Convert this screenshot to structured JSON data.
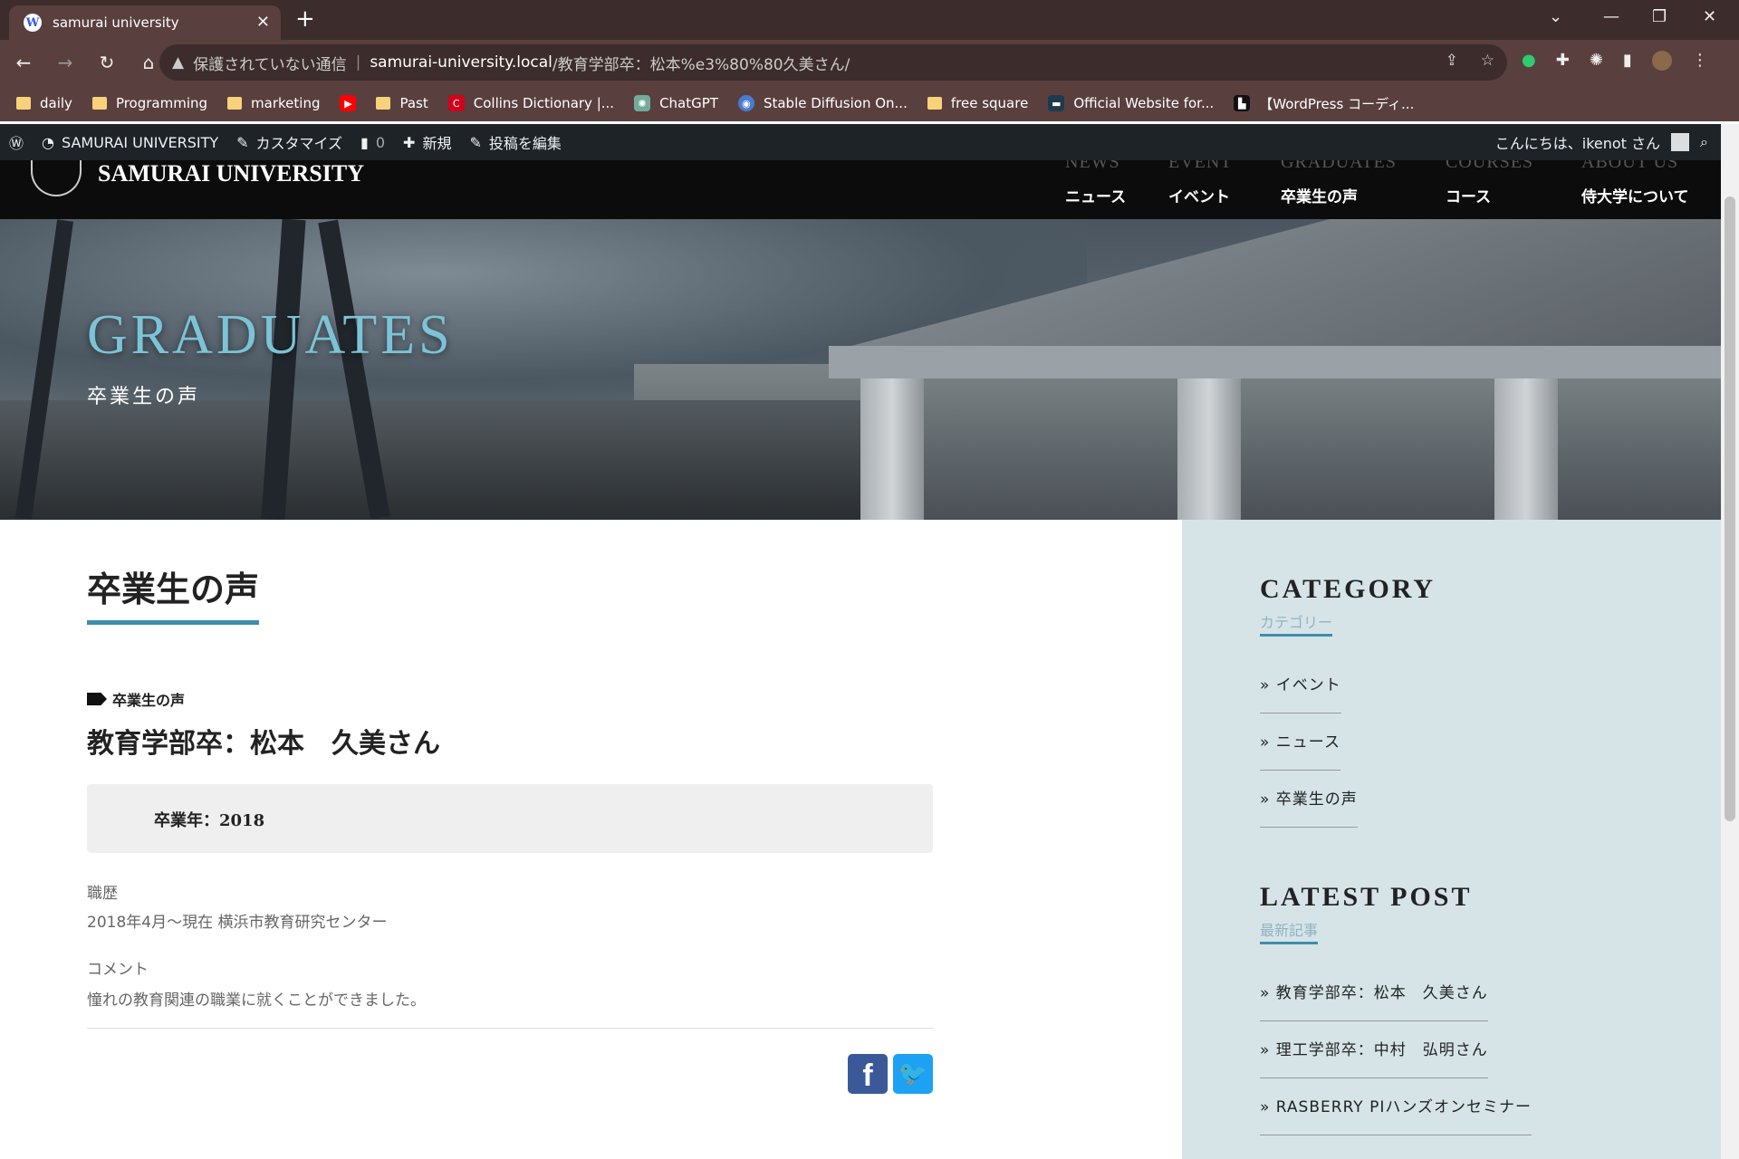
{
  "browser": {
    "tab_title": "samurai university",
    "tab_close": "✕",
    "new_tab": "+",
    "address_warning": "保護されていない通信",
    "address_host": "samurai-university.local",
    "address_path": "/教育学部卒：松本%e3%80%80久美さん/",
    "bookmarks": [
      {
        "label": "daily",
        "icon": "folder-icon"
      },
      {
        "label": "Programming",
        "icon": "folder-icon"
      },
      {
        "label": "marketing",
        "icon": "folder-icon"
      },
      {
        "label": "",
        "icon": "youtube-icon"
      },
      {
        "label": "Past",
        "icon": "folder-icon"
      },
      {
        "label": "Collins Dictionary |...",
        "icon": "collins-icon"
      },
      {
        "label": "ChatGPT",
        "icon": "chatgpt-icon"
      },
      {
        "label": "Stable Diffusion On...",
        "icon": "stable-diffusion-icon"
      },
      {
        "label": "free square",
        "icon": "folder-icon"
      },
      {
        "label": "Official Website for...",
        "icon": "site-icon"
      },
      {
        "label": "【WordPress コーディ...",
        "icon": "site-icon"
      }
    ]
  },
  "adminbar": {
    "site_name": "SAMURAI UNIVERSITY",
    "customize": "カスタマイズ",
    "comments_count": "0",
    "new": "新規",
    "edit_post": "投稿を編集",
    "greeting": "こんにちは、ikenot さん"
  },
  "site": {
    "name": "SAMURAI UNIVERSITY",
    "nav": [
      {
        "en": "NEWS",
        "ja": "ニュース"
      },
      {
        "en": "EVENT",
        "ja": "イベント"
      },
      {
        "en": "GRADUATES",
        "ja": "卒業生の声"
      },
      {
        "en": "COURSES",
        "ja": "コース"
      },
      {
        "en": "ABOUT US",
        "ja": "侍大学について"
      }
    ]
  },
  "hero": {
    "title": "GRADUATES",
    "subtitle": "卒業生の声"
  },
  "main": {
    "page_heading": "卒業生の声",
    "category_tag": "卒業生の声",
    "post_title": "教育学部卒：松本　久美さん",
    "graduation_year": "卒業年：2018",
    "career_label": "職歴",
    "career_value": "2018年4月〜現在 横浜市教育研究センター",
    "comment_label": "コメント",
    "comment_value": "憧れの教育関連の職業に就くことができました。"
  },
  "sidebar": {
    "category_heading": "CATEGORY",
    "category_sub": "カテゴリー",
    "categories": [
      "» イベント",
      "» ニュース",
      "» 卒業生の声"
    ],
    "latest_heading": "LATEST POST",
    "latest_sub": "最新記事",
    "latest_posts": [
      "» 教育学部卒：松本　久美さん",
      "» 理工学部卒：中村　弘明さん",
      "» RASBERRY PIハンズオンセミナー"
    ]
  },
  "colors": {
    "accent": "#3e8fab",
    "hero_title": "#7cc3d7",
    "sidebar_bg": "#d6e4e8"
  }
}
